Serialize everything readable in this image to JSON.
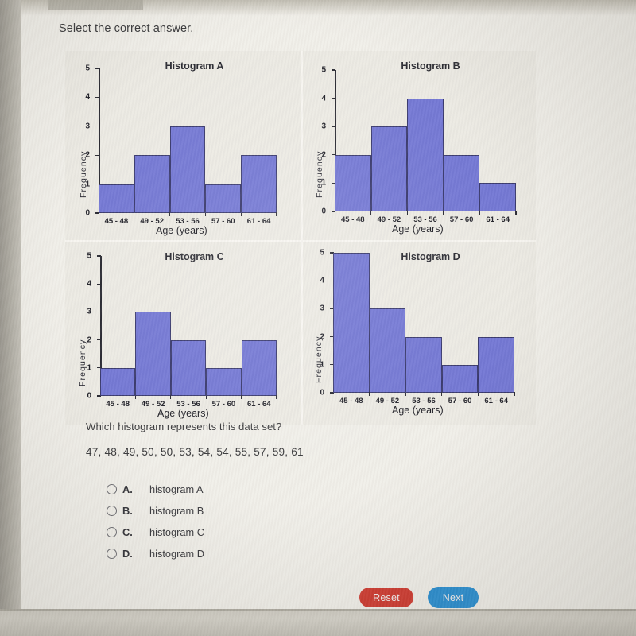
{
  "prompt": "Select the correct answer.",
  "question": "Which histogram represents this data set?",
  "dataset": "47, 48, 49, 50, 50, 53, 54, 54, 55, 57, 59, 61",
  "axis": {
    "xlabel": "Age (years)",
    "ylabel": "Frequency",
    "categories": [
      "45 - 48",
      "49 - 52",
      "53 - 56",
      "57 - 60",
      "61 - 64"
    ],
    "yticks": [
      "0",
      "1",
      "2",
      "3",
      "4",
      "5"
    ],
    "ylim": [
      0,
      5
    ]
  },
  "colors": {
    "bar_fill": "#7478d4",
    "bar_stroke": "#3a3a6e",
    "reset_button": "#cf3c32",
    "next_button": "#2b8fd1",
    "page_background": "#f1efe9",
    "panel_background": "#eceae3"
  },
  "chart_data": [
    {
      "type": "bar",
      "title": "Histogram A",
      "categories": [
        "45 - 48",
        "49 - 52",
        "53 - 56",
        "57 - 60",
        "61 - 64"
      ],
      "values": [
        1,
        2,
        3,
        1,
        2
      ],
      "xlabel": "Age (years)",
      "ylabel": "Frequency",
      "ylim": [
        0,
        5
      ],
      "yticks": [
        0,
        1,
        2,
        3,
        4,
        5
      ],
      "grid": false,
      "legend": "none"
    },
    {
      "type": "bar",
      "title": "Histogram B",
      "categories": [
        "45 - 48",
        "49 - 52",
        "53 - 56",
        "57 - 60",
        "61 - 64"
      ],
      "values": [
        2,
        3,
        4,
        2,
        1
      ],
      "xlabel": "Age (years)",
      "ylabel": "Frequency",
      "ylim": [
        0,
        5
      ],
      "yticks": [
        0,
        1,
        2,
        3,
        4,
        5
      ],
      "grid": false,
      "legend": "none"
    },
    {
      "type": "bar",
      "title": "Histogram C",
      "categories": [
        "45 - 48",
        "49 - 52",
        "53 - 56",
        "57 - 60",
        "61 - 64"
      ],
      "values": [
        1,
        3,
        2,
        1,
        2
      ],
      "xlabel": "Age (years)",
      "ylabel": "Frequency",
      "ylim": [
        0,
        5
      ],
      "yticks": [
        0,
        1,
        2,
        3,
        4,
        5
      ],
      "grid": false,
      "legend": "none"
    },
    {
      "type": "bar",
      "title": "Histogram D",
      "categories": [
        "45 - 48",
        "49 - 52",
        "53 - 56",
        "57 - 60",
        "61 - 64"
      ],
      "values": [
        5,
        3,
        2,
        1,
        2
      ],
      "xlabel": "Age (years)",
      "ylabel": "Frequency",
      "ylim": [
        0,
        5
      ],
      "yticks": [
        0,
        1,
        2,
        3,
        4,
        5
      ],
      "grid": false,
      "legend": "none"
    }
  ],
  "options": [
    {
      "letter": "A.",
      "text": "histogram A",
      "selected": false
    },
    {
      "letter": "B.",
      "text": "histogram B",
      "selected": false
    },
    {
      "letter": "C.",
      "text": "histogram C",
      "selected": false
    },
    {
      "letter": "D.",
      "text": "histogram D",
      "selected": false
    }
  ],
  "buttons": {
    "reset": "Reset",
    "next": "Next"
  }
}
